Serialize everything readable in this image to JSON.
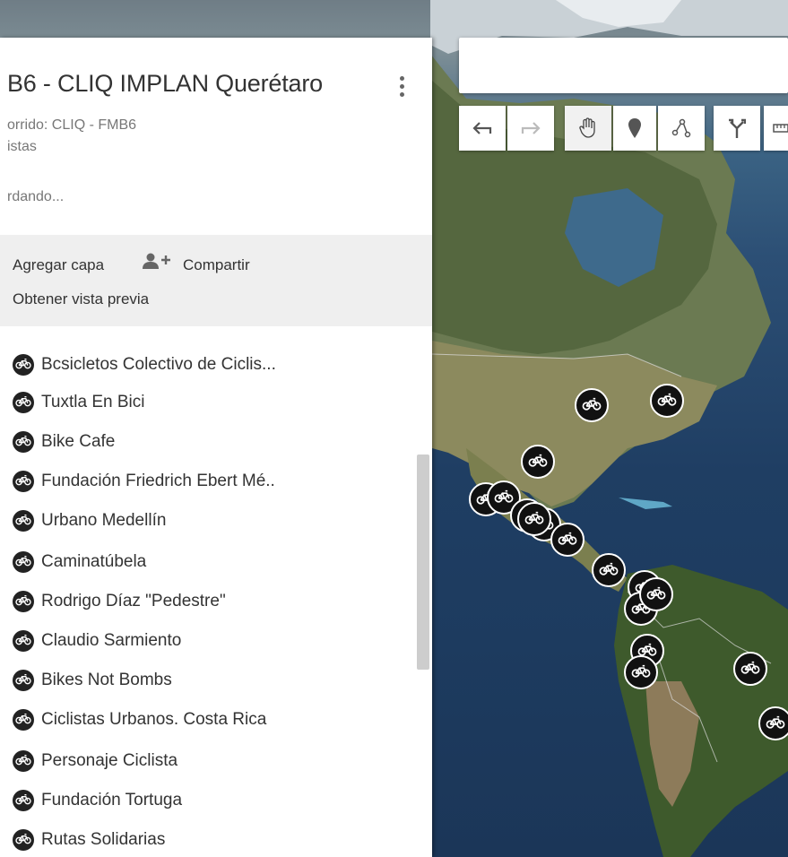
{
  "map_title": "B6 - CLIQ IMPLAN Querétaro",
  "subtitle_route": "orrido: CLIQ - FMB6",
  "subtitle_group": "istas",
  "save_status": "rdando...",
  "actions": {
    "add_layer": "Agregar capa",
    "share": "Compartir",
    "preview": "Obtener vista previa"
  },
  "layers": [
    "Bcsicletos Colectivo de Ciclis...",
    "Tuxtla En Bici",
    "Bike Cafe",
    "Fundación Friedrich Ebert Mé..",
    "Urbano Medellín",
    "Caminatúbela",
    "Rodrigo Díaz \"Pedestre\"",
    "Claudio Sarmiento",
    "Bikes Not Bombs",
    "Ciclistas Urbanos. Costa Rica",
    "Personaje Ciclista",
    "Fundación Tortuga",
    "Rutas Solidarias"
  ],
  "toolbar": [
    "undo-icon",
    "redo-icon",
    "hand-icon",
    "marker-icon",
    "line-icon",
    "directions-icon",
    "ruler-icon"
  ],
  "colors": {
    "marker": "#111111",
    "panel": "#ffffff",
    "actions_bg": "#efefef"
  }
}
